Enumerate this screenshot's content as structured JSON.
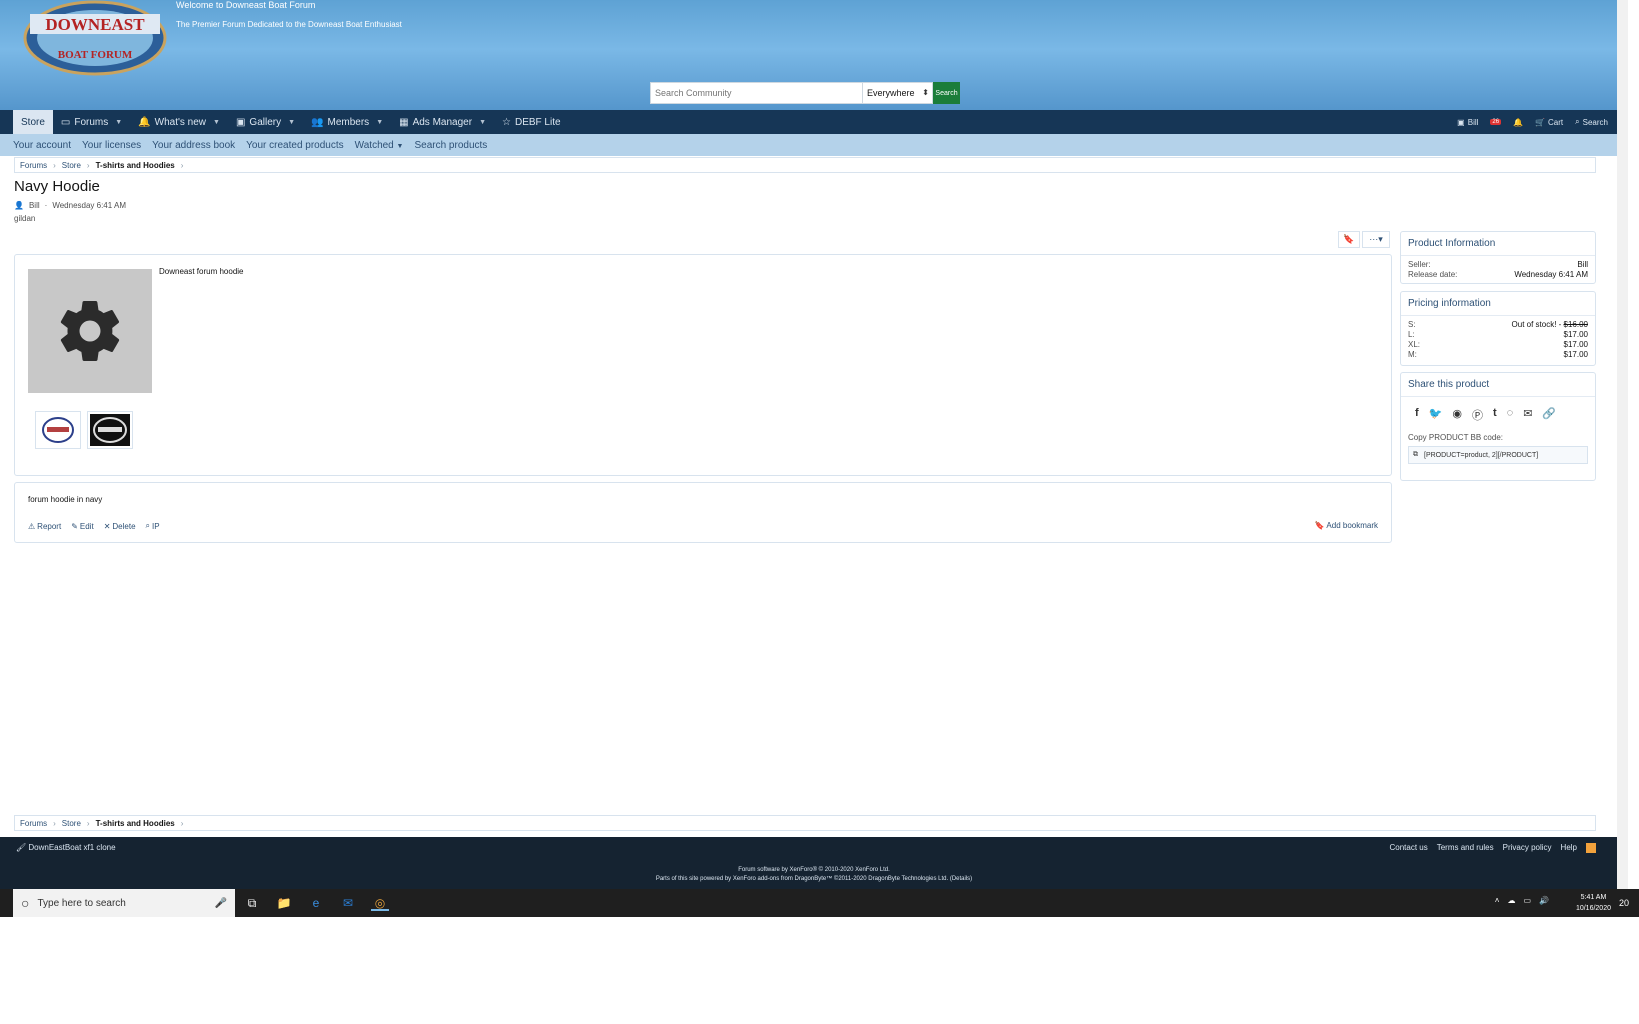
{
  "header": {
    "welcome": "Welcome to Downeast Boat Forum",
    "tagline": "The Premier Forum Dedicated to the Downeast Boat Enthusiast",
    "logo_text_top": "DOWNEAST",
    "logo_text_bottom": "BOAT FORUM",
    "search_placeholder": "Search Community",
    "search_scope": "Everywhere",
    "search_button": "Search"
  },
  "nav": {
    "tabs": [
      {
        "label": "Store"
      },
      {
        "label": "Forums"
      },
      {
        "label": "What's new"
      },
      {
        "label": "Gallery"
      },
      {
        "label": "Members"
      },
      {
        "label": "Ads Manager"
      },
      {
        "label": "DEBF Lite"
      }
    ],
    "user": "Bill",
    "alerts_badge": "26",
    "cart": "Cart",
    "search": "Search"
  },
  "subnav": [
    "Your account",
    "Your licenses",
    "Your address book",
    "Your created products",
    "Watched",
    "Search products"
  ],
  "breadcrumb": [
    "Forums",
    "Store",
    "T-shirts and Hoodies"
  ],
  "product": {
    "title": "Navy Hoodie",
    "author": "Bill",
    "date": "Wednesday 6:41 AM",
    "tag": "gildan",
    "description": "Downeast forum hoodie",
    "body": "forum hoodie in navy"
  },
  "actions": {
    "report": "Report",
    "edit": "Edit",
    "delete": "Delete",
    "ip": "IP",
    "add_bookmark": "Add bookmark"
  },
  "sidebar": {
    "info_title": "Product Information",
    "seller_label": "Seller:",
    "seller_value": "Bill",
    "release_label": "Release date:",
    "release_value": "Wednesday 6:41 AM",
    "pricing_title": "Pricing information",
    "pricing": [
      {
        "size": "S:",
        "note": "Out of stock! - ",
        "price": "$16.00",
        "struck": true
      },
      {
        "size": "L:",
        "note": "",
        "price": "$17.00",
        "struck": false
      },
      {
        "size": "XL:",
        "note": "",
        "price": "$17.00",
        "struck": false
      },
      {
        "size": "M:",
        "note": "",
        "price": "$17.00",
        "struck": false
      }
    ],
    "share_title": "Share this product",
    "bb_label": "Copy PRODUCT BB code:",
    "bb_code": "[PRODUCT=product, 2][/PRODUCT]"
  },
  "footer": {
    "style": "DownEastBoat xf1 clone",
    "links": [
      "Contact us",
      "Terms and rules",
      "Privacy policy",
      "Help"
    ],
    "copyright1": "Forum software by XenForo® © 2010-2020 XenForo Ltd.",
    "copyright2": "Parts of this site powered by XenForo add-ons from DragonByte™ ©2011-2020 DragonByte Technologies Ltd. (Details)"
  },
  "taskbar": {
    "search_placeholder": "Type here to search",
    "time": "5:41 AM",
    "date": "10/16/2020",
    "notif": "20"
  }
}
